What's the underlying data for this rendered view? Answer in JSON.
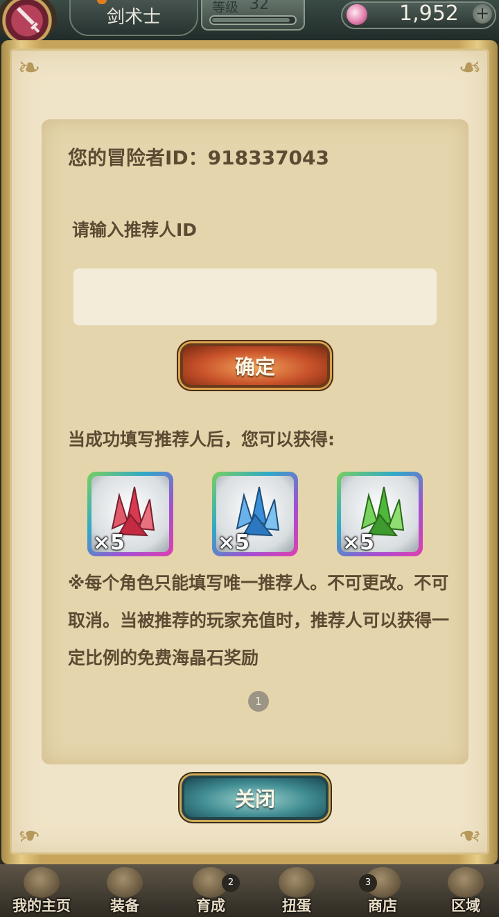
{
  "header": {
    "class_name": "剑术士",
    "level_label": "等级",
    "level_value": "32",
    "exp_progress": 0.95,
    "currency_amount": "1,952",
    "currency_icon": "crystal-gem-icon",
    "add_icon": "plus-icon"
  },
  "dialog": {
    "adventurer_id_text": "您的冒险者ID：918337043",
    "referrer_prompt": "请输入推荐人ID",
    "referrer_input_value": "",
    "confirm_label": "确定",
    "reward_title": "当成功填写推荐人后，您可以获得:",
    "rewards": [
      {
        "icon": "red-crystal-icon",
        "color": "#d8394f",
        "count": "×5"
      },
      {
        "icon": "blue-crystal-icon",
        "color": "#3a8fd8",
        "count": "×5"
      },
      {
        "icon": "green-crystal-icon",
        "color": "#4fb83a",
        "count": "×5"
      }
    ],
    "note": "※每个角色只能填写唯一推荐人。不可更改。不可取消。当被推荐的玩家充值时，推荐人可以获得一定比例的免费海晶石奖励",
    "page_indicator": "1",
    "close_label": "关闭"
  },
  "bottom_nav": {
    "items": [
      {
        "label": "我的主页",
        "icon": "scroll-home-icon",
        "badge": ""
      },
      {
        "label": "装备",
        "icon": "helmet-icon",
        "badge": ""
      },
      {
        "label": "育成",
        "icon": "sword-icon",
        "badge": "2"
      },
      {
        "label": "扭蛋",
        "icon": "treasure-pot-icon",
        "badge": ""
      },
      {
        "label": "商店",
        "icon": "gold-bag-icon",
        "badge": "3"
      },
      {
        "label": "区域",
        "icon": "globe-icon",
        "badge": ""
      }
    ]
  }
}
